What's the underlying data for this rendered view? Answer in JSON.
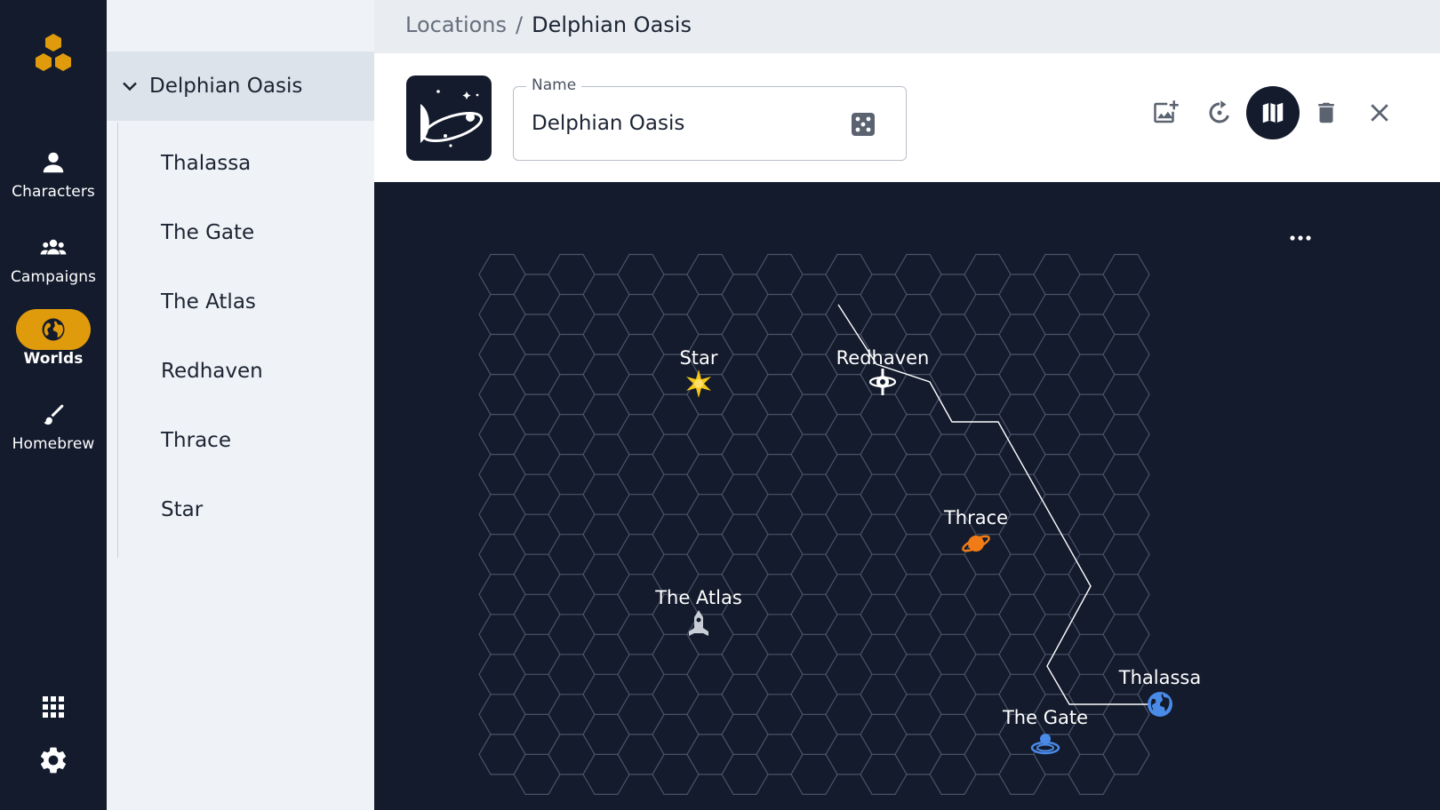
{
  "nav": {
    "items": [
      {
        "label": "Characters",
        "icon": "person-icon"
      },
      {
        "label": "Campaigns",
        "icon": "group-icon"
      },
      {
        "label": "Worlds",
        "icon": "globe-icon",
        "active": true
      },
      {
        "label": "Homebrew",
        "icon": "brush-icon"
      }
    ],
    "bottom_icons": [
      "apps-grid-icon",
      "settings-gear-icon"
    ],
    "accent_color": "#e09b0c"
  },
  "breadcrumb": {
    "parent": "Locations",
    "separator": "/",
    "current": "Delphian Oasis"
  },
  "tree": {
    "root": "Delphian Oasis",
    "children": [
      "Thalassa",
      "The Gate",
      "The Atlas",
      "Redhaven",
      "Thrace",
      "Star"
    ]
  },
  "header": {
    "name_label": "Name",
    "name_value": "Delphian Oasis",
    "actions": [
      "add-image-icon",
      "rotate-icon",
      "map-icon",
      "delete-icon",
      "close-icon"
    ]
  },
  "map": {
    "background": "#131b2d",
    "locations": [
      {
        "name": "Star",
        "icon": "star-icon",
        "color": "#f5c518"
      },
      {
        "name": "Redhaven",
        "icon": "space-station-icon",
        "color": "#ffffff"
      },
      {
        "name": "Thrace",
        "icon": "planet-icon",
        "color": "#f07b17"
      },
      {
        "name": "The Atlas",
        "icon": "spaceship-icon",
        "color": "#c9ced6"
      },
      {
        "name": "Thalassa",
        "icon": "earth-icon",
        "color": "#4a8be8"
      },
      {
        "name": "The Gate",
        "icon": "portal-icon",
        "color": "#4a8be8"
      }
    ]
  }
}
